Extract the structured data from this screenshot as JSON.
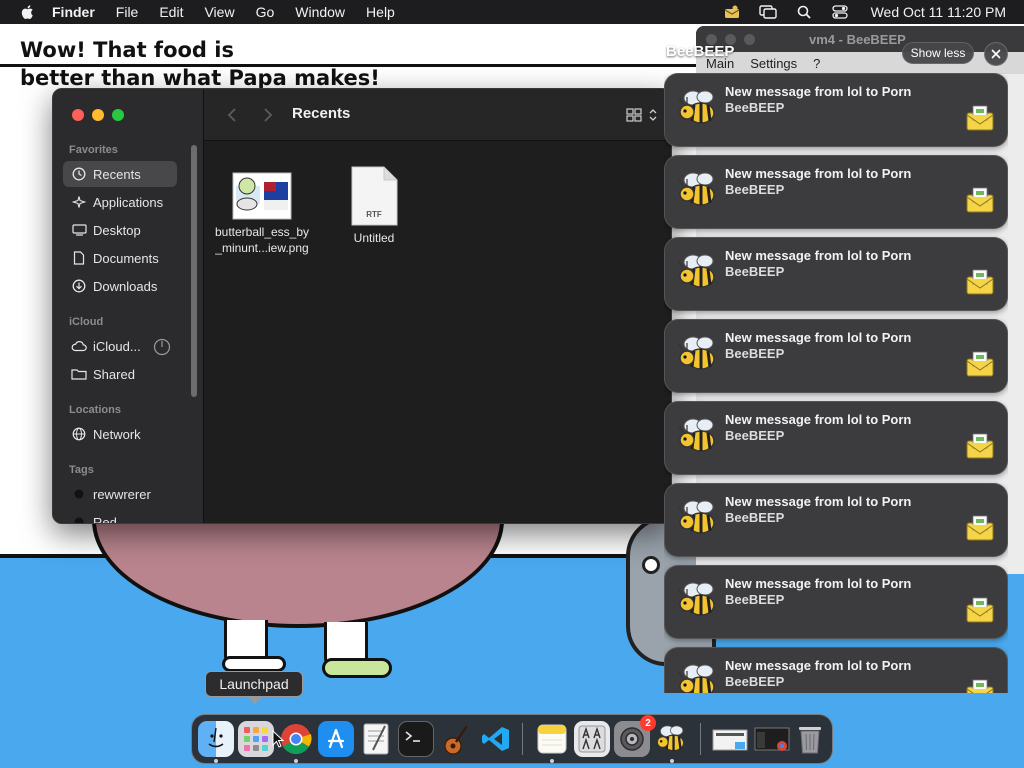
{
  "menubar": {
    "apple_icon": "apple-icon",
    "app_name": "Finder",
    "menus": [
      "File",
      "Edit",
      "View",
      "Go",
      "Window",
      "Help"
    ],
    "status_icons": [
      "beebeep-status-icon",
      "screen-mirroring-icon",
      "spotlight-search-icon",
      "control-center-icon"
    ],
    "clock": "Wed Oct 11  11:20 PM"
  },
  "wallpaper": {
    "caption_line1": "Wow! That food is",
    "caption_line2": "better than what Papa makes!"
  },
  "beebeep_window": {
    "title": "vm4 - BeeBEEP",
    "menus": [
      "Main",
      "Settings",
      "?"
    ]
  },
  "notification_stack": {
    "app_name": "BeeBEEP",
    "show_less_label": "Show less",
    "items": [
      {
        "title": "New message from lol to Porn",
        "subtitle": "BeeBEEP"
      },
      {
        "title": "New message from lol to Porn",
        "subtitle": "BeeBEEP"
      },
      {
        "title": "New message from lol to Porn",
        "subtitle": "BeeBEEP"
      },
      {
        "title": "New message from lol to Porn",
        "subtitle": "BeeBEEP"
      },
      {
        "title": "New message from lol to Porn",
        "subtitle": "BeeBEEP"
      },
      {
        "title": "New message from lol to Porn",
        "subtitle": "BeeBEEP"
      },
      {
        "title": "New message from lol to Porn",
        "subtitle": "BeeBEEP"
      },
      {
        "title": "New message from lol to Porn",
        "subtitle": "BeeBEEP"
      }
    ]
  },
  "finder": {
    "title": "Recents",
    "sidebar": {
      "favorites_header": "Favorites",
      "favorites": [
        {
          "label": "Recents",
          "icon": "clock-icon",
          "selected": true
        },
        {
          "label": "Applications",
          "icon": "applications-icon"
        },
        {
          "label": "Desktop",
          "icon": "desktop-icon"
        },
        {
          "label": "Documents",
          "icon": "document-icon"
        },
        {
          "label": "Downloads",
          "icon": "download-icon"
        }
      ],
      "icloud_header": "iCloud",
      "icloud": [
        {
          "label": "iCloud...",
          "icon": "cloud-icon"
        },
        {
          "label": "Shared",
          "icon": "shared-folder-icon"
        }
      ],
      "locations_header": "Locations",
      "locations": [
        {
          "label": "Network",
          "icon": "globe-icon"
        }
      ],
      "tags_header": "Tags",
      "tags": [
        {
          "label": "rewwrerer",
          "color": "#1c1c1c"
        },
        {
          "label": "Red",
          "color": "#1c1c1c"
        }
      ]
    },
    "files": [
      {
        "name_line1": "butterball_ess_by",
        "name_line2": "_minunt...iew.png",
        "type": "image"
      },
      {
        "name_line1": "Untitled",
        "name_line2": "",
        "type": "rtf",
        "badge": "RTF"
      }
    ]
  },
  "tooltip": {
    "label": "Launchpad"
  },
  "dock": {
    "apps": [
      {
        "name": "finder",
        "icon": "finder-icon",
        "running": true
      },
      {
        "name": "launchpad",
        "icon": "launchpad-icon",
        "running": false
      },
      {
        "name": "chrome",
        "icon": "chrome-icon",
        "running": true
      },
      {
        "name": "app-store",
        "icon": "app-store-icon",
        "running": false
      },
      {
        "name": "textedit",
        "icon": "textedit-icon",
        "running": false
      },
      {
        "name": "terminal",
        "icon": "terminal-icon",
        "running": false
      },
      {
        "name": "garageband",
        "icon": "guitar-icon",
        "running": false
      },
      {
        "name": "vscode",
        "icon": "vscode-icon",
        "running": false
      },
      {
        "name": "notes",
        "icon": "notes-icon",
        "running": true
      },
      {
        "name": "font-book",
        "icon": "font-book-icon",
        "running": false
      },
      {
        "name": "system-settings",
        "icon": "gear-icon",
        "running": false,
        "badge": "2"
      },
      {
        "name": "beebeep",
        "icon": "bee-icon",
        "running": true
      },
      {
        "name": "downloads-stack",
        "icon": "downloads-stack-icon",
        "running": false
      },
      {
        "name": "window-thumbnail",
        "icon": "window-thumbnail-icon",
        "running": false
      },
      {
        "name": "trash",
        "icon": "trash-icon",
        "running": false
      }
    ],
    "badge_text": "2",
    "rtf_label": "RTF"
  },
  "colors": {
    "menubar_bg": "#1d1d1f",
    "sidebar_bg": "#2b2b2d",
    "notification_bg": "#3c3c3e",
    "wallpaper_blue": "#4aa8ee"
  }
}
